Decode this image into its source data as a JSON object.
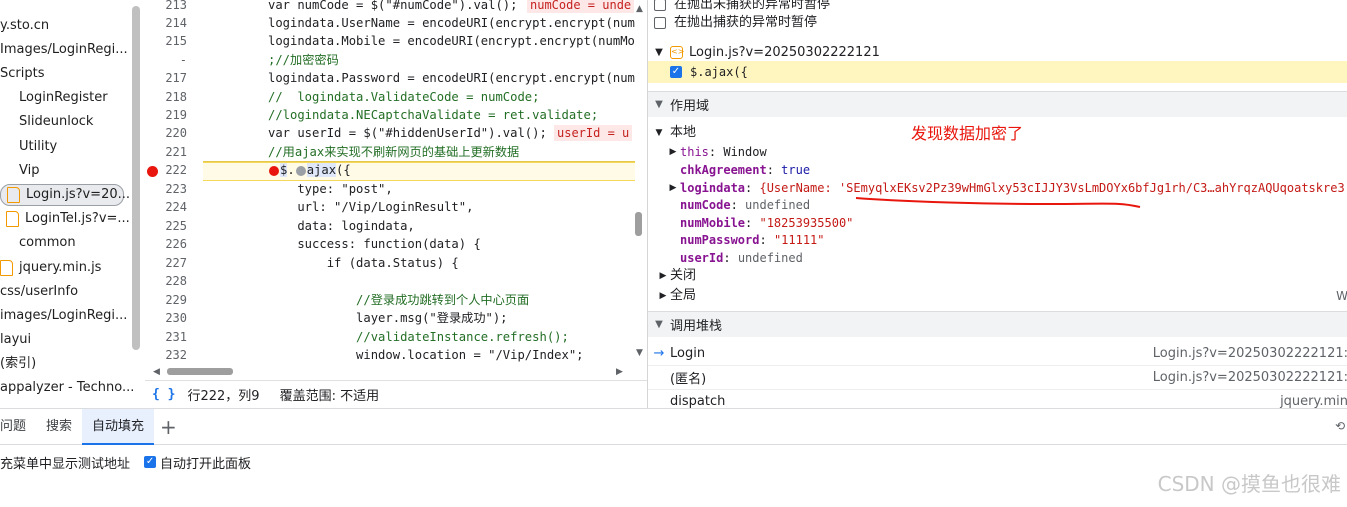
{
  "file_tree": {
    "items": [
      {
        "label": "y.sto.cn",
        "icon": "none",
        "selected": false
      },
      {
        "label": "Images/LoginRegi...",
        "icon": "none",
        "selected": false
      },
      {
        "label": "Scripts",
        "icon": "none",
        "selected": false
      },
      {
        "label": "LoginRegister",
        "icon": "folder-icon",
        "selected": false
      },
      {
        "label": "Slideunlock",
        "icon": "folder-icon",
        "selected": false
      },
      {
        "label": "Utility",
        "icon": "folder-icon",
        "selected": false
      },
      {
        "label": "Vip",
        "icon": "folder-icon",
        "selected": false
      },
      {
        "label": "Login.js?v=20...",
        "icon": "file-icon",
        "selected": true
      },
      {
        "label": "LoginTel.js?v=...",
        "icon": "file-icon",
        "selected": false
      },
      {
        "label": "common",
        "icon": "folder-icon",
        "selected": false
      },
      {
        "label": "jquery.min.js",
        "icon": "file-icon",
        "selected": false
      },
      {
        "label": "css/userInfo",
        "icon": "none",
        "selected": false
      },
      {
        "label": "images/LoginRegi...",
        "icon": "none",
        "selected": false
      },
      {
        "label": "layui",
        "icon": "none",
        "selected": false
      },
      {
        "label": "(索引)",
        "icon": "none",
        "selected": false
      },
      {
        "label": "appalyzer - Techno...",
        "icon": "none",
        "selected": false
      }
    ]
  },
  "editor": {
    "breakpoint_color": "#e8160c",
    "lines": [
      {
        "num": "213",
        "code": "var numCode = $(\"#numCode\").val();"
      },
      {
        "num": "214",
        "code": "logindata.UserName = encodeURI(encrypt.encrypt(num"
      },
      {
        "num": "215",
        "code": "logindata.Mobile = encodeURI(encrypt.encrypt(numMo"
      },
      {
        "num": "-",
        "code": ";//加密密码"
      },
      {
        "num": "217",
        "code": "logindata.Password = encodeURI(encrypt.encrypt(num"
      },
      {
        "num": "218",
        "code": "//  logindata.ValidateCode = numCode;"
      },
      {
        "num": "219",
        "code": "//logindata.NECaptchaValidate = ret.validate;"
      },
      {
        "num": "220",
        "code": "var userId = $(\"#hiddenUserId\").val();"
      },
      {
        "num": "221",
        "code": "//用ajax来实现不刷新网页的基础上更新数据"
      },
      {
        "num": "222",
        "code": "$.ajax({"
      },
      {
        "num": "223",
        "code": "    type: \"post\","
      },
      {
        "num": "224",
        "code": "    url: \"/Vip/LoginResult\","
      },
      {
        "num": "225",
        "code": "    data: logindata,"
      },
      {
        "num": "226",
        "code": "    success: function(data) {"
      },
      {
        "num": "227",
        "code": "        if (data.Status) {"
      },
      {
        "num": "228",
        "code": ""
      },
      {
        "num": "229",
        "code": "            //登录成功跳转到个人中心页面"
      },
      {
        "num": "230",
        "code": "            layer.msg(\"登录成功\");"
      },
      {
        "num": "231",
        "code": "            //validateInstance.refresh();"
      },
      {
        "num": "232",
        "code": "            window.location = \"/Vip/Index\";"
      }
    ],
    "inline_values": {
      "line_213": "numCode = unde",
      "line_220": "userId = u"
    }
  },
  "editor_status": {
    "braces": "{ }",
    "position": "行222，列9",
    "coverage": "覆盖范围: 不适用"
  },
  "sidebar": {
    "pause_options": [
      {
        "label": "在抛出未捕获的异常时暂停",
        "checked": false
      },
      {
        "label": "在抛出捕获的异常时暂停",
        "checked": false
      }
    ],
    "breakpoint_file": "Login.js?v=20250302222121",
    "breakpoint_code": "$.ajax({",
    "scope_header": "作用域",
    "local_header": "本地",
    "scope_vars": [
      {
        "name": "this",
        "value": "Window",
        "type": "plain",
        "expandable": true
      },
      {
        "name": "chkAgreement",
        "value": "true",
        "type": "kw",
        "expandable": false
      },
      {
        "name": "logindata",
        "value": "{UserName: 'SEmyqlxEKsv2Pz39wHmGlxy53cIJJY3VsLmDOYx6bfJg1rh/C3…ahYrqzAQUqoatskre3",
        "type": "obj",
        "expandable": true
      },
      {
        "name": "numCode",
        "value": "undefined",
        "type": "undef",
        "expandable": false
      },
      {
        "name": "numMobile",
        "value": "\"18253935500\"",
        "type": "str",
        "expandable": false
      },
      {
        "name": "numPassword",
        "value": "\"11111\"",
        "type": "str",
        "expandable": false
      },
      {
        "name": "userId",
        "value": "undefined",
        "type": "undef",
        "expandable": false
      }
    ],
    "closure_label": "关闭",
    "global_label": "全局",
    "global_value": "W",
    "callstack_header": "调用堆栈",
    "callstack": [
      {
        "name": "Login",
        "location": "Login.js?v=20250302222121:",
        "current": true
      },
      {
        "name": "(匿名)",
        "location": "Login.js?v=20250302222121:",
        "current": false
      },
      {
        "name": "dispatch",
        "location": "jquery.min",
        "current": false
      }
    ],
    "annotation": "发现数据加密了",
    "annotation_color": "#e8160c"
  },
  "drawer": {
    "tabs": [
      {
        "label": "问题",
        "active": false
      },
      {
        "label": "搜索",
        "active": false
      },
      {
        "label": "自动填充",
        "active": true
      }
    ],
    "add_tab": "+",
    "option_text": "充菜单中显示测试地址",
    "autoopen_label": "自动打开此面板",
    "autoopen_checked": true,
    "right_icon": "⟲"
  },
  "watermark": "CSDN @摸鱼也很难"
}
